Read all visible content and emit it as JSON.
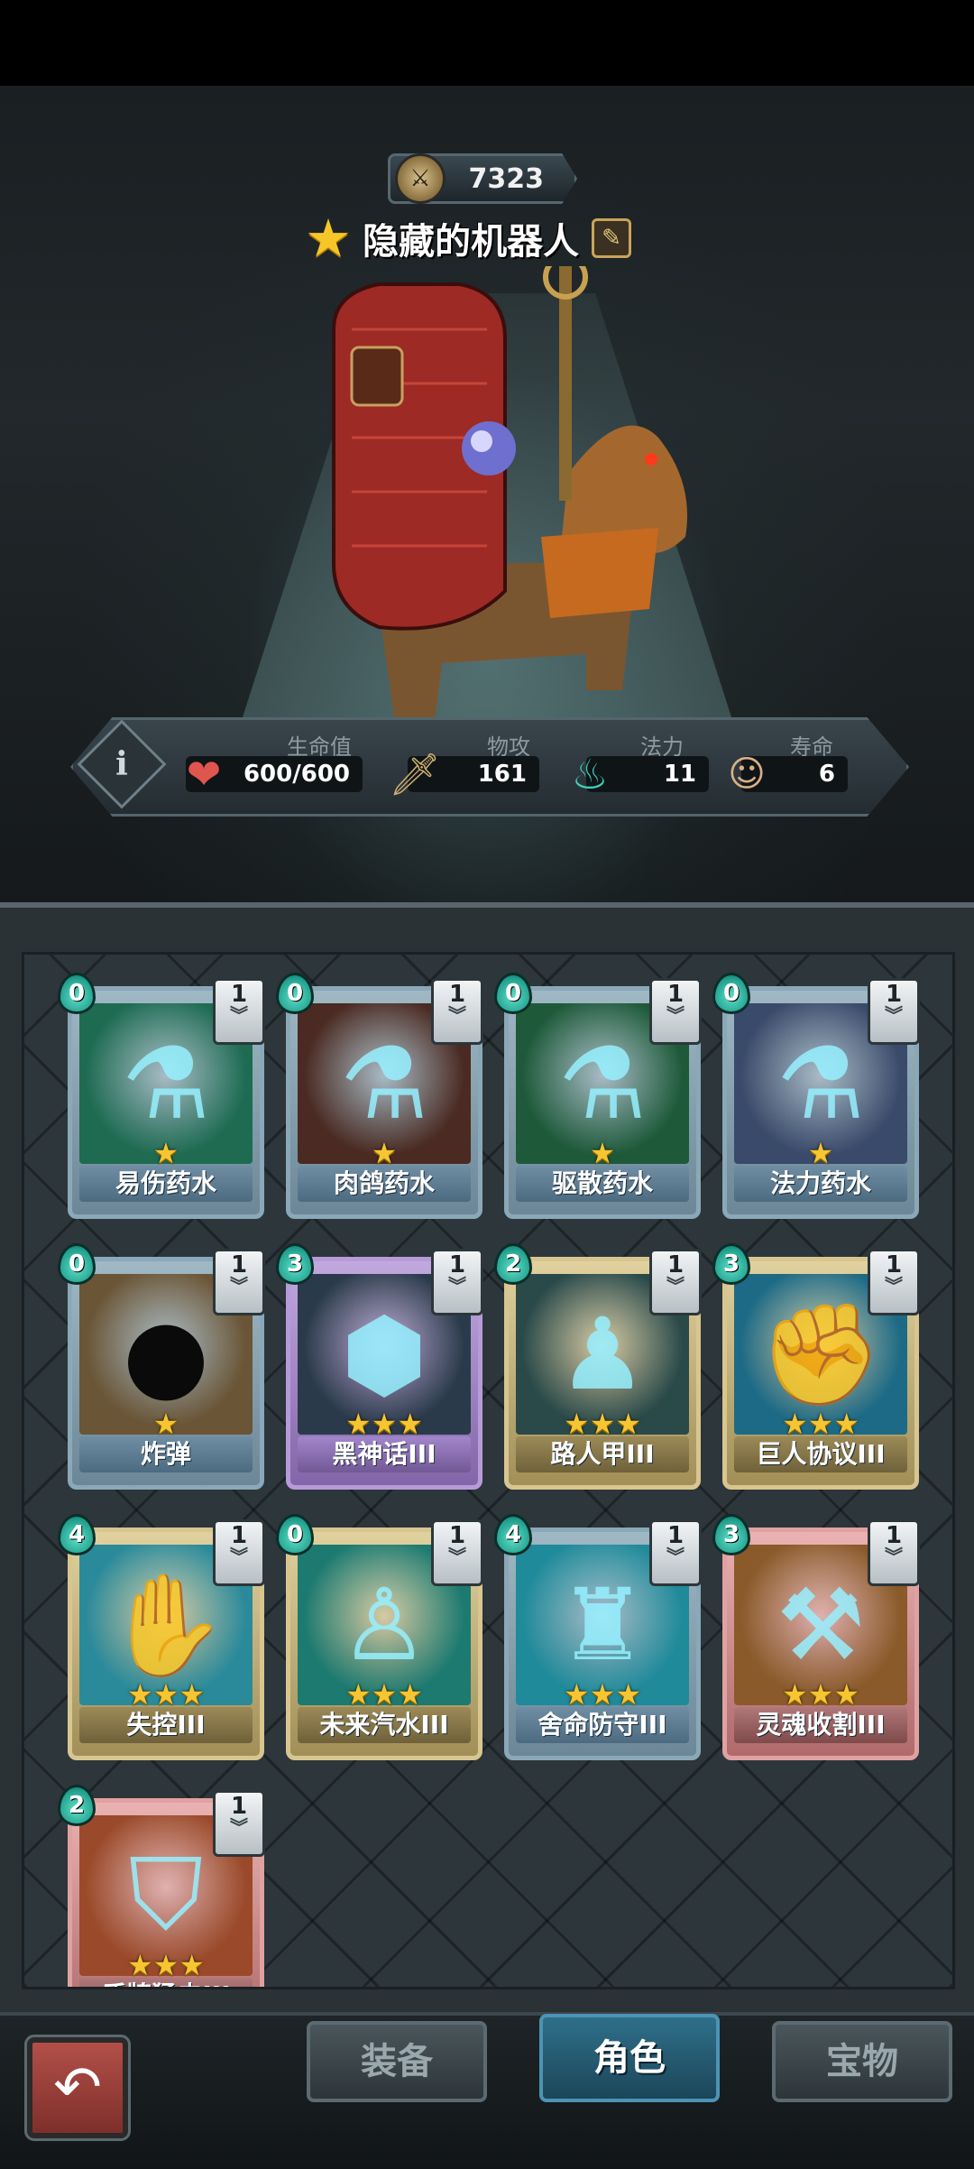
{
  "hero": {
    "score": "7323",
    "name": "隐藏的机器人"
  },
  "stats": {
    "hp_label": "生命值",
    "hp_value": "600/600",
    "atk_label": "物攻",
    "atk_value": "161",
    "mana_label": "法力",
    "mana_value": "11",
    "life_label": "寿命",
    "life_value": "6"
  },
  "skills": [
    "body-icon",
    "sword-icon",
    "leap-icon",
    "demon-icon",
    "spiral-icon"
  ],
  "cards": [
    {
      "name": "易伤药水",
      "cost": "0",
      "level": "1",
      "stars": "★",
      "frame": "blue",
      "icon": "potion-icon",
      "art_color": "#1e6b52"
    },
    {
      "name": "肉鸽药水",
      "cost": "0",
      "level": "1",
      "stars": "★",
      "frame": "blue",
      "icon": "potion-icon",
      "art_color": "#4a2a22"
    },
    {
      "name": "驱散药水",
      "cost": "0",
      "level": "1",
      "stars": "★",
      "frame": "blue",
      "icon": "potion-icon",
      "art_color": "#1e5a3a"
    },
    {
      "name": "法力药水",
      "cost": "0",
      "level": "1",
      "stars": "★",
      "frame": "blue",
      "icon": "potion-icon",
      "art_color": "#3a4a6a"
    },
    {
      "name": "炸弹",
      "cost": "0",
      "level": "1",
      "stars": "★",
      "frame": "blue",
      "icon": "bomb-icon",
      "art_color": "#6a5536"
    },
    {
      "name": "黑神话III",
      "cost": "3",
      "level": "1",
      "stars": "★★★",
      "frame": "purple",
      "icon": "stone-icon",
      "art_color": "#2a3a4a"
    },
    {
      "name": "路人甲III",
      "cost": "2",
      "level": "1",
      "stars": "★★★",
      "frame": "gold",
      "icon": "figure-icon",
      "art_color": "#2a4a4a"
    },
    {
      "name": "巨人协议III",
      "cost": "3",
      "level": "1",
      "stars": "★★★",
      "frame": "gold",
      "icon": "fist-icon",
      "art_color": "#1d6a86"
    },
    {
      "name": "失控III",
      "cost": "4",
      "level": "1",
      "stars": "★★★",
      "frame": "gold",
      "icon": "claw-icon",
      "art_color": "#2a8a9a"
    },
    {
      "name": "未来汽水III",
      "cost": "0",
      "level": "1",
      "stars": "★★★",
      "frame": "gold",
      "icon": "bottle-icon",
      "art_color": "#1c7a70"
    },
    {
      "name": "舍命防守III",
      "cost": "4",
      "level": "1",
      "stars": "★★★",
      "frame": "blue",
      "icon": "shield-figure-icon",
      "art_color": "#1f8a9a"
    },
    {
      "name": "灵魂收割III",
      "cost": "3",
      "level": "1",
      "stars": "★★★",
      "frame": "red",
      "icon": "scythe-icon",
      "art_color": "#8a5a2a"
    },
    {
      "name": "盾牌猛击III",
      "cost": "2",
      "level": "1",
      "stars": "★★★",
      "frame": "red",
      "icon": "shield-icon",
      "art_color": "#9a4a2a"
    }
  ],
  "tabs": {
    "equip": "装备",
    "role": "角色",
    "treasure": "宝物"
  }
}
